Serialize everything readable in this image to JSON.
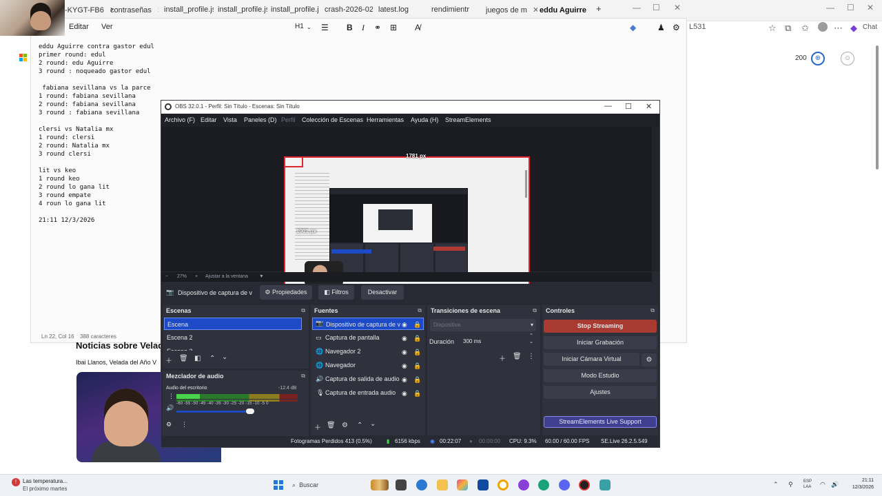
{
  "browser": {
    "tabs": [
      {
        "label": "-KYGT-FB6"
      },
      {
        "label": "contraseñas"
      },
      {
        "label": "install_profile.json"
      },
      {
        "label": "install_profile.json"
      },
      {
        "label": "install_profile.json"
      },
      {
        "label": "crash-2026-02-22_"
      },
      {
        "label": "latest.log"
      },
      {
        "label": "rendimientr"
      },
      {
        "label": "juegos de m"
      },
      {
        "label": "eddu Aguirre"
      }
    ],
    "new_tab": "+",
    "address_partial": "L531",
    "side_count": "200",
    "side_badge": "⊕",
    "chat_label": "Chat"
  },
  "notepad": {
    "menu": {
      "edit": "Editar",
      "view": "Ver"
    },
    "format": {
      "heading": "H1",
      "bold": "B",
      "italic": "I"
    },
    "lines": [
      "eddu Aguirre contra gastor edul",
      "primer round: edul",
      "2 round: edu Aguirre",
      "3 round : noqueado gastor edul",
      "",
      " fabiana sevillana vs la parce",
      "1 round: fabiana sevillana",
      "2 round: fabiana sevillana",
      "3 round : fabiana sevillana",
      "",
      "clersi vs Natalia mx",
      "1 round: clersi",
      "2 round: Natalia mx",
      "3 round clersi",
      "",
      "lit vs keo",
      "1 round keo",
      "2 round lo gana lit",
      "3 round empate",
      "4 roun lo gana lit",
      "",
      "21:11 12/3/2026"
    ],
    "status_pos": "Ln 22, Col 16",
    "status_chars": "388 caracteres"
  },
  "webpage": {
    "news_title": "Noticias sobre Velad",
    "news_sub": "Ibai Llanos, Velada del Año V"
  },
  "obs": {
    "title": "OBS 32.0.1 - Perfil: Sin Título - Escenas: Sin Título",
    "menu": [
      {
        "label": "Archivo (F)"
      },
      {
        "label": "Editar"
      },
      {
        "label": "Vista"
      },
      {
        "label": "Paneles (D)"
      },
      {
        "label": "Perfil"
      },
      {
        "label": "Colección de Escenas"
      },
      {
        "label": "Herramientas"
      },
      {
        "label": "Ayuda (H)"
      },
      {
        "label": "StreamElements"
      }
    ],
    "preview": {
      "width_label": "1781 px",
      "height_label": "1001 px"
    },
    "zoom": {
      "minus": "−",
      "level": "27%",
      "plus": "+",
      "fit": "Ajustar a la ventana"
    },
    "source_toolbar": {
      "selected_source": "Dispositivo de captura de v",
      "properties": "Propiedades",
      "filters": "Filtros",
      "deactivate": "Desactivar"
    },
    "scenes": {
      "title": "Escenas",
      "items": [
        {
          "label": "Escena"
        },
        {
          "label": "Escena 2"
        },
        {
          "label": "Escena 3"
        }
      ]
    },
    "sources": {
      "title": "Fuentes",
      "items": [
        {
          "label": "Dispositivo de captura de v",
          "icon": "camera-icon"
        },
        {
          "label": "Captura de pantalla",
          "icon": "monitor-icon"
        },
        {
          "label": "Navegador 2",
          "icon": "globe-icon"
        },
        {
          "label": "Navegador",
          "icon": "globe-icon"
        },
        {
          "label": "Captura de salida de audio",
          "icon": "speaker-icon"
        },
        {
          "label": "Captura de entrada audio",
          "icon": "microphone-icon"
        }
      ]
    },
    "transitions": {
      "title": "Transiciones de escena",
      "type": "Diapositiva",
      "duration_label": "Duración",
      "duration_value": "300 ms"
    },
    "controls": {
      "title": "Controles",
      "stop_streaming": "Stop Streaming",
      "start_recording": "Iniciar Grabación",
      "start_virtual_cam": "Iniciar Cámara Virtual",
      "studio_mode": "Modo Estudio",
      "settings": "Ajustes",
      "se_support": "StreamElements Live Support"
    },
    "mixer": {
      "title": "Mezclador de audio",
      "channel": "Audio del escritorio",
      "db": "-12.4 dB",
      "scale": "-60 -55 -50 -45 -40 -35 -30 -25 -20 -15 -10 -5 0"
    },
    "status": {
      "dropped": "Fotogramas Perdidos 413 (0.5%)",
      "bitrate": "6156 kbps",
      "stream_time": "00:22:07",
      "rec_time": "00:00:00",
      "cpu": "CPU: 9.3%",
      "fps": "60.00 / 60.00 FPS",
      "se_version": "SE.Live 26.2.5.549"
    }
  },
  "taskbar": {
    "weather_title": "Las temperatura...",
    "weather_sub": "El próximo martes",
    "search": "Buscar",
    "lang_top": "ESP",
    "lang_bottom": "LAA",
    "time": "21:11",
    "date": "12/3/2026"
  }
}
